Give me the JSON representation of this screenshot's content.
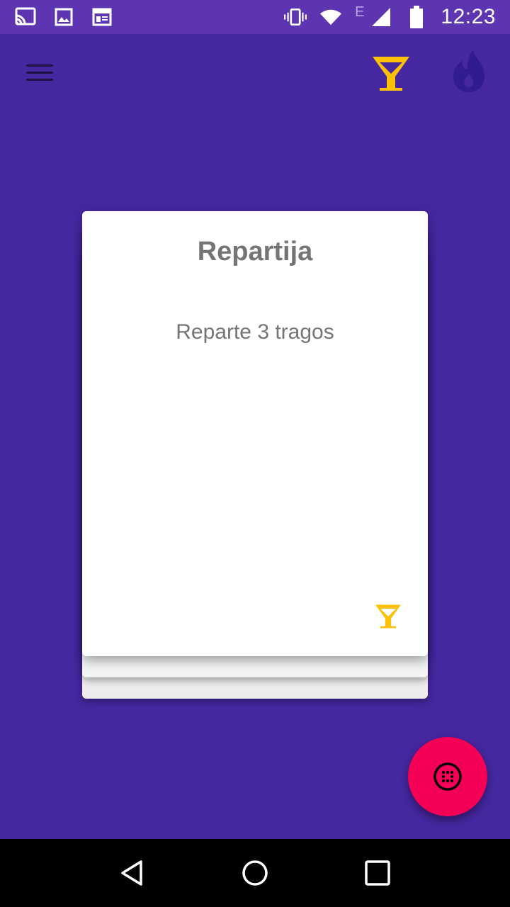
{
  "status_bar": {
    "time": "12:23",
    "network_type": "E",
    "icons": [
      "cast-icon",
      "image-icon",
      "news-icon",
      "vibrate-icon",
      "wifi-icon",
      "signal-icon",
      "battery-icon"
    ]
  },
  "app_bar": {
    "menu_icon": "menu-icon",
    "drink_mode_icon": "cocktail-icon",
    "hot_mode_icon": "fire-icon",
    "active_color": "#FFC107",
    "inactive_color": "#311B92"
  },
  "card": {
    "title": "Repartija",
    "body": "Reparte 3 tragos",
    "icon": "cocktail-icon",
    "icon_color": "#FFC107"
  },
  "fab": {
    "icon": "dice-icon",
    "color": "#F50057"
  },
  "nav_bar": {
    "icons": [
      "back-icon",
      "home-icon",
      "recents-icon"
    ]
  },
  "colors": {
    "background": "#4527A0",
    "status_bar": "#5E35B1",
    "card_text": "#757575"
  }
}
